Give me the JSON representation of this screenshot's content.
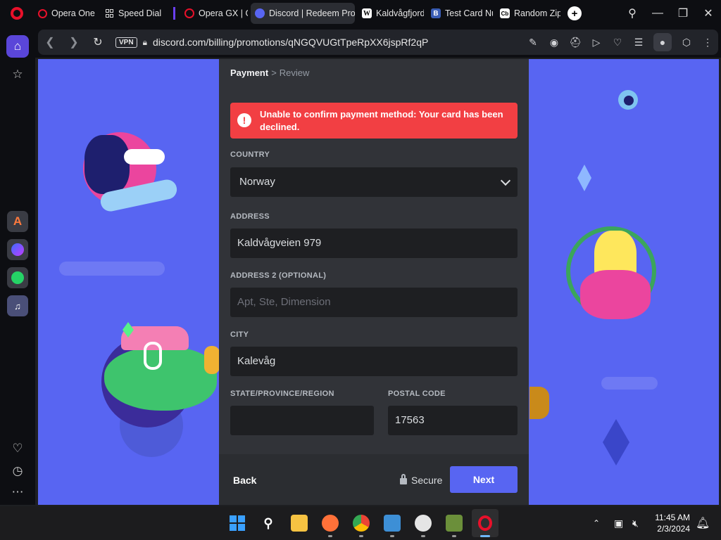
{
  "tabs": [
    {
      "label": "Opera One",
      "icon": "opera-icon"
    },
    {
      "label": "Speed Dial",
      "icon": "speed-dial-icon"
    },
    {
      "label": "Opera GX | G",
      "icon": "opera-gx-icon"
    },
    {
      "label": "Discord | Redeem Pro",
      "icon": "discord-icon",
      "active": true
    },
    {
      "label": "Kaldvågfjord",
      "icon": "wikipedia-icon"
    },
    {
      "label": "Test Card Nu",
      "icon": "b-icon"
    },
    {
      "label": "Random Zip",
      "icon": "cb-icon"
    }
  ],
  "addressbar": {
    "vpn": "VPN",
    "url": "discord.com/billing/promotions/qNGQVUGtTpeRpXX6jspRf2qP"
  },
  "modal": {
    "breadcrumb": {
      "current": "Payment",
      "next": "Review"
    },
    "error": "Unable to confirm payment method: Your card has been declined.",
    "country": {
      "label": "COUNTRY",
      "value": "Norway"
    },
    "address": {
      "label": "ADDRESS",
      "value": "Kaldvågveien 979"
    },
    "address2": {
      "label": "ADDRESS 2 (OPTIONAL)",
      "placeholder": "Apt, Ste, Dimension"
    },
    "city": {
      "label": "CITY",
      "value": "Kalevåg"
    },
    "state": {
      "label": "STATE/PROVINCE/REGION",
      "value": ""
    },
    "postal": {
      "label": "POSTAL CODE",
      "value": "17563"
    },
    "footer": {
      "back": "Back",
      "secure": "Secure",
      "next": "Next"
    }
  },
  "taskbar": {
    "time": "11:45 AM",
    "date": "2/3/2024"
  },
  "colors": {
    "blurple": "#5865f2",
    "danger": "#f23f43",
    "modal_bg": "#313338",
    "input_bg": "#1e1f22",
    "opera_red": "#e8102a"
  }
}
